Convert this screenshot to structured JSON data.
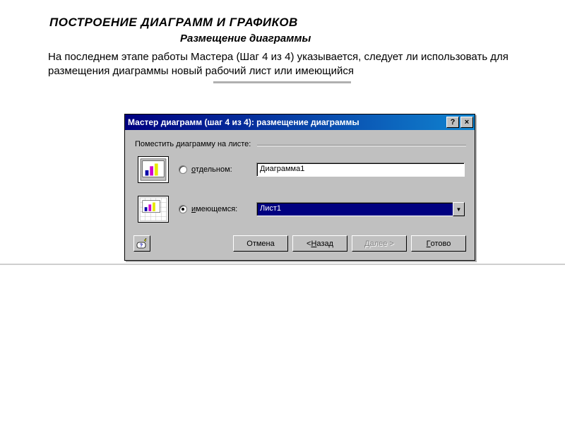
{
  "page": {
    "title": "ПОСТРОЕНИЕ  ДИАГРАММ И ГРАФИКОВ",
    "subtitle": "Размещение диаграммы",
    "description": "На последнем этапе работы Мастера (Шаг 4 из 4) указывается, следует ли использовать для размещения диаграммы новый рабочий лист или  имеющийся"
  },
  "dialog": {
    "title": "Мастер диаграмм (шаг 4 из 4): размещение диаграммы",
    "help_btn": "?",
    "close_btn": "×",
    "group_label": "Поместить диаграмму на листе:",
    "option_separate": {
      "prefix": "о",
      "suffix": "тдельном:",
      "value": "Диаграмма1",
      "checked": false
    },
    "option_existing": {
      "prefix": "и",
      "suffix": "меющемся:",
      "value": "Лист1",
      "checked": true
    },
    "buttons": {
      "cancel": "Отмена",
      "back_prefix": "< ",
      "back_u": "Н",
      "back_suffix": "азад",
      "next_prefix": "Д",
      "next_suffix": "алее >",
      "finish_u": "Г",
      "finish_suffix": "отово"
    }
  }
}
